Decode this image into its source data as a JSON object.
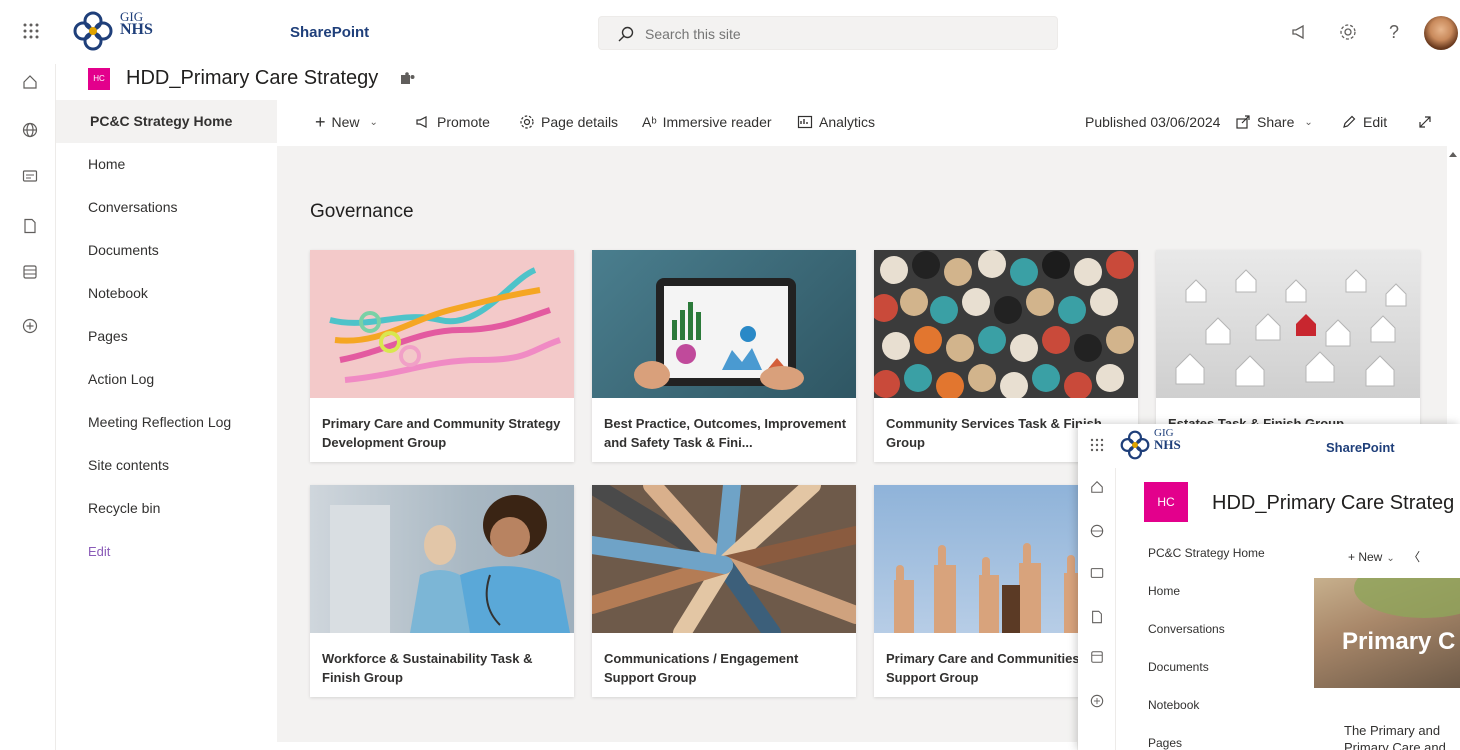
{
  "suite": {
    "logo_small": "GIG",
    "logo_big": "NHS",
    "app_name": "SharePoint",
    "search_placeholder": "Search this site"
  },
  "site": {
    "badge": "HC",
    "title": "HDD_Primary Care Strategy"
  },
  "nav": {
    "items": [
      {
        "label": "PC&C Strategy Home"
      },
      {
        "label": "Home"
      },
      {
        "label": "Conversations"
      },
      {
        "label": "Documents"
      },
      {
        "label": "Notebook"
      },
      {
        "label": "Pages"
      },
      {
        "label": "Action Log"
      },
      {
        "label": "Meeting Reflection Log"
      },
      {
        "label": "Site contents"
      },
      {
        "label": "Recycle bin"
      }
    ],
    "edit_label": "Edit"
  },
  "commands": {
    "new": "New",
    "promote": "Promote",
    "page_details": "Page details",
    "immersive_reader": "Immersive reader",
    "analytics": "Analytics",
    "published": "Published 03/06/2024",
    "share": "Share",
    "edit": "Edit"
  },
  "section": {
    "title": "Governance"
  },
  "cards": [
    {
      "title": "Primary Care and Community Strategy Development Group"
    },
    {
      "title": "Best Practice, Outcomes, Improvement and Safety Task & Fini..."
    },
    {
      "title": "Community Services Task & Finish Group"
    },
    {
      "title": "Estates Task & Finish Group"
    },
    {
      "title": "Workforce & Sustainability Task & Finish Group"
    },
    {
      "title": "Communications / Engagement Support Group"
    },
    {
      "title": "Primary Care and Communities Support Group"
    }
  ],
  "overlay": {
    "logo_small": "GIG",
    "logo_big": "NHS",
    "app_name": "SharePoint",
    "badge": "HC",
    "title": "HDD_Primary Care Strateg",
    "nav": [
      {
        "label": "PC&C Strategy Home"
      },
      {
        "label": "Home"
      },
      {
        "label": "Conversations"
      },
      {
        "label": "Documents"
      },
      {
        "label": "Notebook"
      },
      {
        "label": "Pages"
      }
    ],
    "cmd_new": "New",
    "hero_text": "Primary C",
    "body_line1": "The Primary and",
    "body_line2": "Primary Care and"
  },
  "colors": {
    "brand_pink": "#e3008c",
    "nhs_blue": "#1f3f7a",
    "edit_purple": "#8a5bb8"
  }
}
